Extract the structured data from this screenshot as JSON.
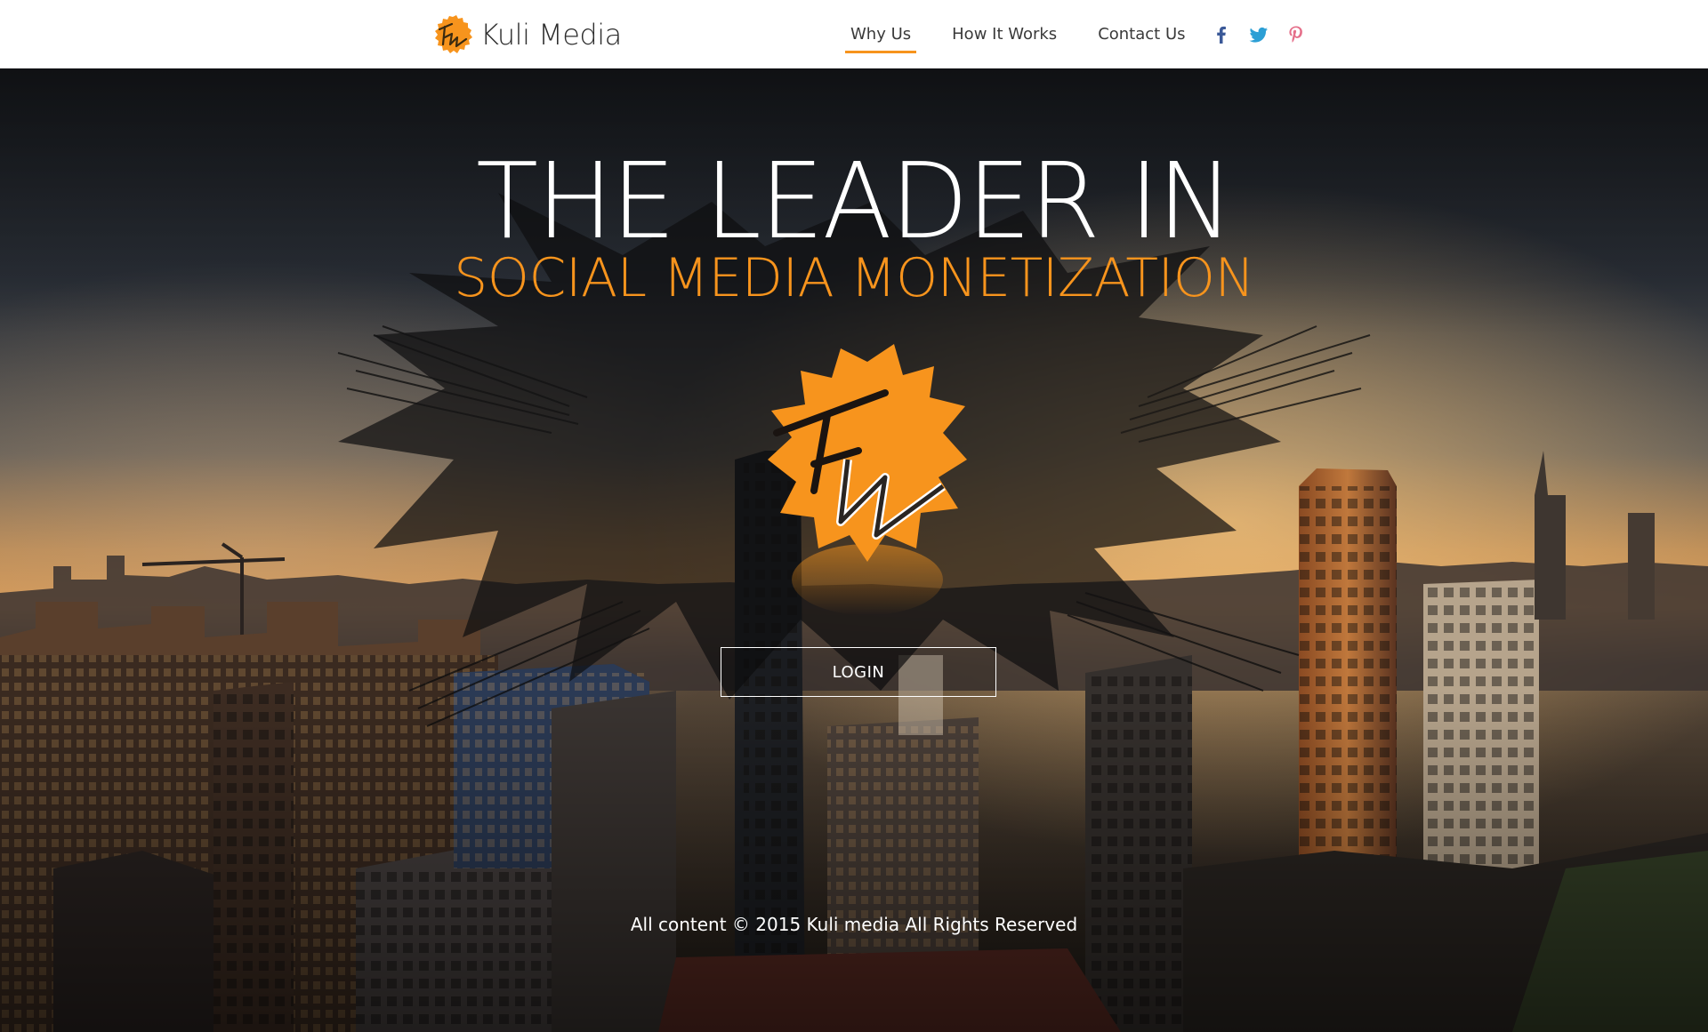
{
  "brand": {
    "name": "Kuli Media",
    "logo_icon": "kuli-media-km-logo-icon",
    "accent_color": "#f7941d"
  },
  "nav": {
    "items": [
      {
        "label": "Why Us",
        "active": true
      },
      {
        "label": "How It Works",
        "active": false
      },
      {
        "label": "Contact Us",
        "active": false
      }
    ],
    "social": [
      {
        "icon": "facebook-icon",
        "color": "#3b5998"
      },
      {
        "icon": "twitter-icon",
        "color": "#2c9fd5"
      },
      {
        "icon": "pinterest-icon",
        "color": "#e56f8a"
      }
    ]
  },
  "hero": {
    "headline": "THE LEADER IN",
    "subheadline": "SOCIAL MEDIA MONETIZATION",
    "background_icon": "city-skyline-photo",
    "login_label": "LOGIN"
  },
  "footer": {
    "copyright": "All content © 2015 Kuli media All Rights Reserved"
  }
}
